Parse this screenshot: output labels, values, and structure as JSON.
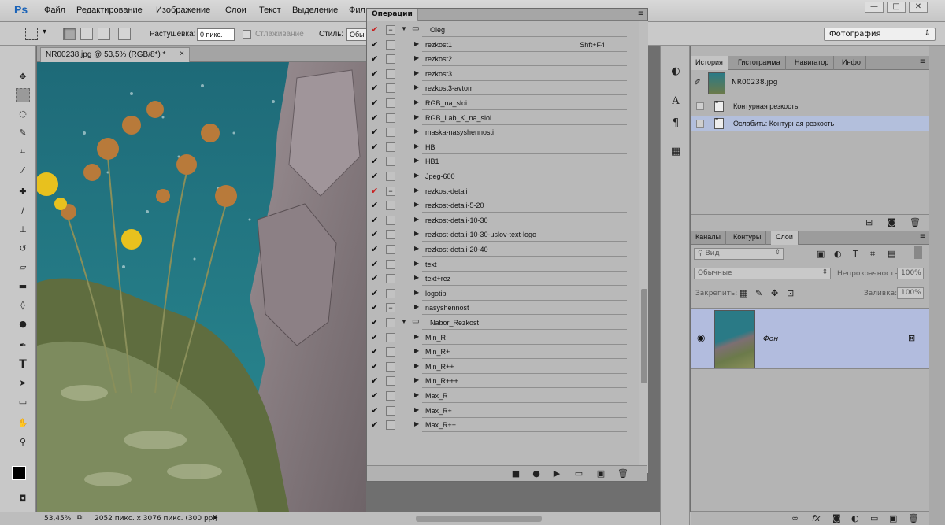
{
  "app": {
    "logo": "Ps"
  },
  "menu": [
    "Файл",
    "Редактирование",
    "Изображение",
    "Слои",
    "Текст",
    "Выделение",
    "Фил"
  ],
  "window_controls": [
    "—",
    "□",
    "✕"
  ],
  "options": {
    "feather_label": "Растушевка:",
    "feather_value": "0 пикс.",
    "antialias_label": "Сглаживание",
    "style_label": "Стиль:",
    "style_value": "Обы",
    "workspace": "Фотография"
  },
  "document": {
    "tab_title": "NR00238.jpg @ 53,5% (RGB/8*) *",
    "close": "×"
  },
  "status": {
    "zoom": "53,45%",
    "info": "2052 пикс. x 3076 пикс. (300 ppi)"
  },
  "actions_panel": {
    "tab": "Операции",
    "set1": "Oleg",
    "items": [
      {
        "label": "rezkost1",
        "shortcut": "Shft+F4"
      },
      {
        "label": "rezkost2",
        "shortcut": ""
      },
      {
        "label": "rezkost3",
        "shortcut": ""
      },
      {
        "label": "rezkost3-avtom",
        "shortcut": ""
      },
      {
        "label": "RGB_na_sloi",
        "shortcut": ""
      },
      {
        "label": "RGB_Lab_K_na_sloi",
        "shortcut": ""
      },
      {
        "label": "maska-nasyshennosti",
        "shortcut": ""
      },
      {
        "label": "HB",
        "shortcut": ""
      },
      {
        "label": "HB1",
        "shortcut": ""
      },
      {
        "label": "Jpeg-600",
        "shortcut": ""
      },
      {
        "label": "rezkost-detali",
        "shortcut": ""
      },
      {
        "label": "rezkost-detali-5-20",
        "shortcut": ""
      },
      {
        "label": "rezkost-detali-10-30",
        "shortcut": ""
      },
      {
        "label": "rezkost-detali-10-30-uslov-text-logo",
        "shortcut": ""
      },
      {
        "label": "rezkost-detali-20-40",
        "shortcut": ""
      },
      {
        "label": "text",
        "shortcut": ""
      },
      {
        "label": "text+rez",
        "shortcut": ""
      },
      {
        "label": "logotip",
        "shortcut": ""
      },
      {
        "label": "nasyshennost",
        "shortcut": ""
      }
    ],
    "set2": "Nabor_Rezkost",
    "items2": [
      "Min_R",
      "Min_R+",
      "Min_R++",
      "Min_R+++",
      "Max_R",
      "Max_R+",
      "Max_R++"
    ],
    "footer": [
      "■",
      "●",
      "▶",
      "▭",
      "▣",
      "🗑"
    ]
  },
  "history_panel": {
    "tabs": [
      "История",
      "Гистограмма",
      "Навигатор",
      "Инфо"
    ],
    "snapshot": "NR00238.jpg",
    "steps": [
      "Контурная резкость",
      "Ослабить: Контурная резкость"
    ]
  },
  "layers_panel": {
    "tabs": [
      "Каналы",
      "Контуры",
      "Слои"
    ],
    "filter_placeholder": "Вид",
    "blend_mode": "Обычные",
    "opacity_label": "Непрозрачность:",
    "opacity_value": "100%",
    "lock_label": "Закрепить:",
    "fill_label": "Заливка:",
    "fill_value": "100%",
    "layer_name": "Фон"
  },
  "colors": {
    "accent": "#1a63b8",
    "selected_row": "#b3bfdc",
    "check_red": "#c82020"
  }
}
